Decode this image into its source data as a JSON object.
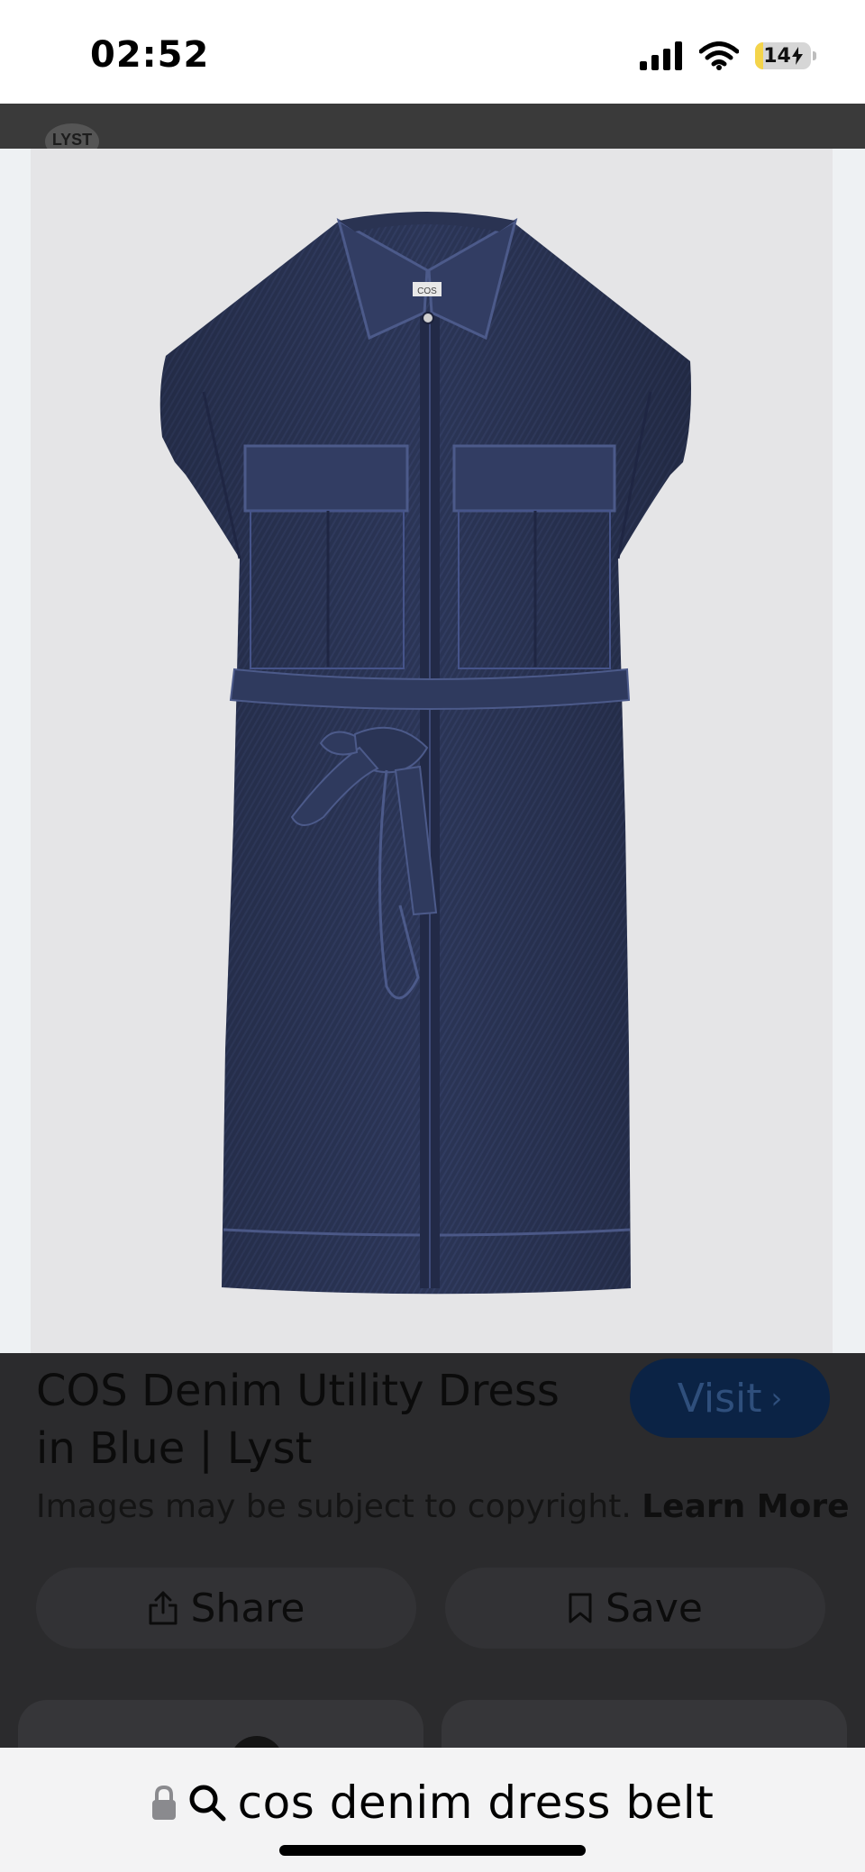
{
  "status_bar": {
    "time": "02:52",
    "battery_level": "14",
    "battery_fraction": 0.14
  },
  "header": {
    "logo_text": "LYST"
  },
  "image": {
    "label_text": "COS",
    "colors": {
      "background": "#e5e5e7",
      "denim": "#2b3556"
    }
  },
  "result": {
    "title": "COS Denim Utility Dress in Blue | Lyst",
    "visit_label": "Visit",
    "copyright_text": "Images may be subject to copyright.",
    "learn_more_label": "Learn More",
    "share_label": "Share",
    "save_label": "Save"
  },
  "address_bar": {
    "query": "cos denim dress belt"
  },
  "colors": {
    "overlay": "#2b2b2d",
    "visit_button": "#0b2345"
  }
}
